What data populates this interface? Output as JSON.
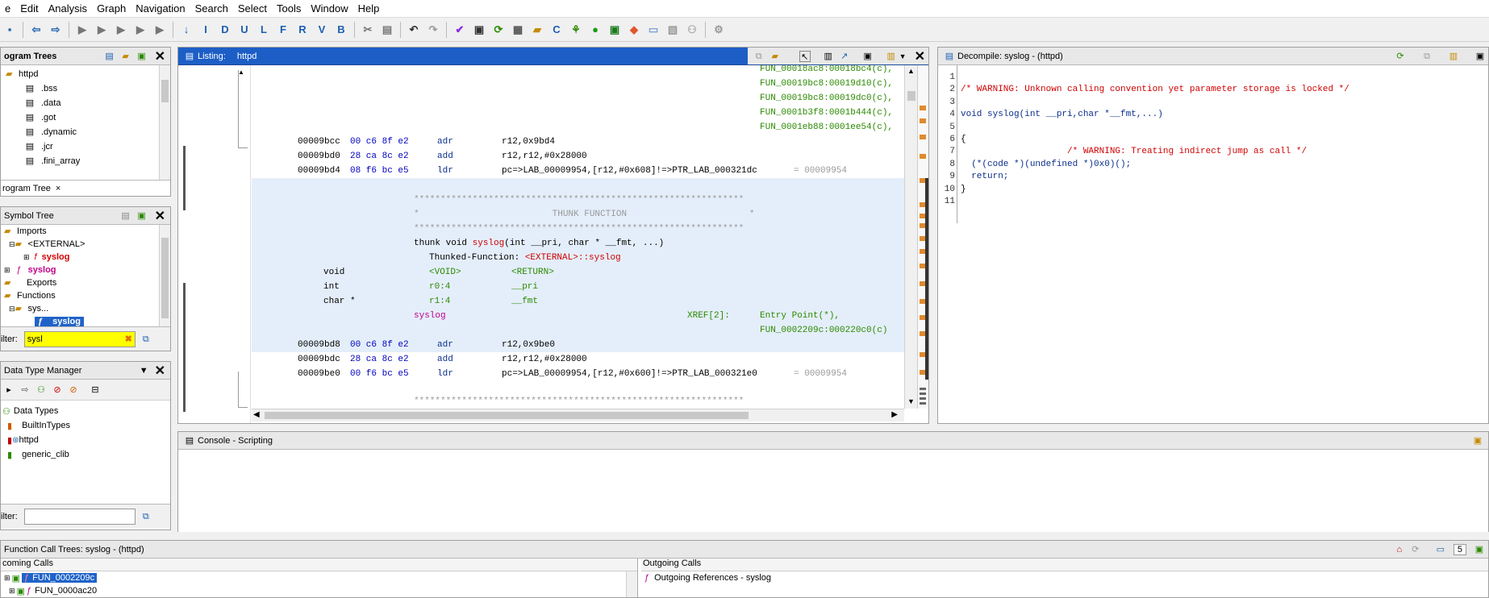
{
  "menu": [
    "e",
    "Edit",
    "Analysis",
    "Graph",
    "Navigation",
    "Search",
    "Select",
    "Tools",
    "Window",
    "Help"
  ],
  "program_trees": {
    "title": "ogram Trees",
    "root": "httpd",
    "items": [
      ".bss",
      ".data",
      ".got",
      ".dynamic",
      ".jcr",
      ".fini_array"
    ],
    "tab": "rogram Tree"
  },
  "symbol_tree": {
    "title": "Symbol Tree",
    "imports": "Imports",
    "external": "<EXTERNAL>",
    "import_fn": "syslog",
    "exports": "Exports",
    "export_fn": "syslog",
    "functions": "Functions",
    "folder": "sys...",
    "selected": "syslog",
    "filter_label": "ilter:",
    "filter_value": "sysl"
  },
  "data_type_manager": {
    "title": "Data Type Manager",
    "root": "Data Types",
    "items": [
      "BuiltInTypes",
      "httpd",
      "generic_clib"
    ],
    "filter_label": "ilter:"
  },
  "listing": {
    "title": "Listing:",
    "program": "httpd",
    "xref_top": [
      "FUN_00018ac8:00018bc4(c),",
      "FUN_00019bc8:00019d10(c),",
      "FUN_00019bc8:00019dc0(c),",
      "FUN_0001b3f8:0001b444(c),",
      "FUN_0001eb88:0001ee54(c),"
    ],
    "rows1": [
      {
        "addr": "00009bcc",
        "bytes": "00 c6 8f e2",
        "mn": "adr",
        "op": "r12,0x9bd4"
      },
      {
        "addr": "00009bd0",
        "bytes": "28 ca 8c e2",
        "mn": "add",
        "op": "r12,r12,#0x28000"
      },
      {
        "addr": "00009bd4",
        "bytes": "08 f6 bc e5",
        "mn": "ldr",
        "op": "pc=>LAB_00009954,[r12,#0x608]!=>PTR_LAB_000321dc",
        "cmt": "= 00009954"
      }
    ],
    "stars": "**************************************************************",
    "thunk_banner": "*                         THUNK FUNCTION                       *",
    "sig_prefix": "thunk void ",
    "sig_name": "syslog",
    "sig_args": "(int __pri, char * __fmt, ...)",
    "thunked_label": "Thunked-Function: ",
    "thunked_target": "<EXTERNAL>::syslog",
    "params": [
      {
        "type": "void",
        "loc": "<VOID>",
        "name": "<RETURN>"
      },
      {
        "type": "int",
        "loc": "r0:4",
        "name": "__pri"
      },
      {
        "type": "char *",
        "loc": "r1:4",
        "name": "__fmt"
      }
    ],
    "label": "syslog",
    "xref_label": "XREF[2]:",
    "xref1": "Entry Point(*),",
    "xref2": "FUN_0002209c:000220c0(c)",
    "rows2": [
      {
        "addr": "00009bd8",
        "bytes": "00 c6 8f e2",
        "mn": "adr",
        "op": "r12,0x9be0"
      },
      {
        "addr": "00009bdc",
        "bytes": "28 ca 8c e2",
        "mn": "add",
        "op": "r12,r12,#0x28000"
      },
      {
        "addr": "00009be0",
        "bytes": "00 f6 bc e5",
        "mn": "ldr",
        "op": "pc=>LAB_00009954,[r12,#0x600]!=>PTR_LAB_000321e0",
        "cmt": "= 00009954"
      }
    ]
  },
  "decompile": {
    "title": "Decompile: syslog -  (httpd)",
    "line_numbers": [
      "1",
      "2",
      "3",
      "4",
      "5",
      "6",
      "7",
      "8",
      "9",
      "10",
      "11"
    ],
    "lines": [
      "",
      "/* WARNING: Unknown calling convention yet parameter storage is locked */",
      "",
      "void syslog(int __pri,char *__fmt,...)",
      "",
      "{",
      "                    /* WARNING: Treating indirect jump as call */",
      "  (*(code *)(undefined *)0x0)();",
      "  return;",
      "}",
      ""
    ]
  },
  "console": {
    "title": "Console - Scripting"
  },
  "call_trees": {
    "title": "Function Call Trees: syslog -  (httpd)",
    "incoming": "coming Calls",
    "outgoing": "Outgoing Calls",
    "in_items": [
      "FUN_0002209c",
      "FUN_0000ac20"
    ],
    "out_item": "Outgoing References - syslog",
    "depth": "5"
  }
}
